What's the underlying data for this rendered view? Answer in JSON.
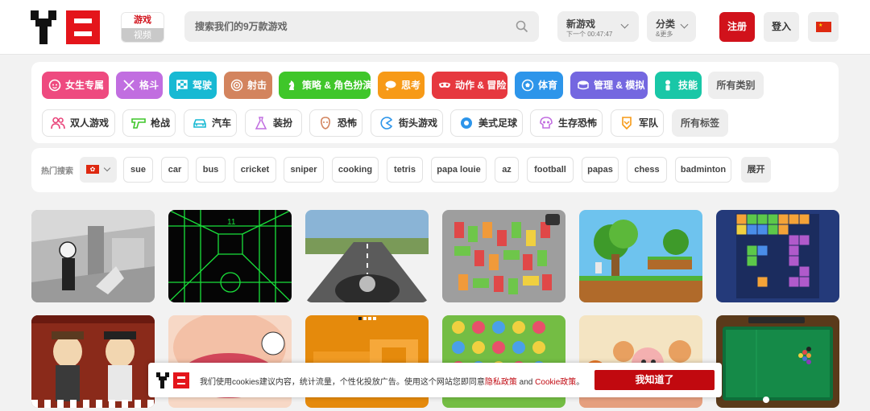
{
  "header": {
    "logo_alt": "Y8",
    "tab_games": "游戏",
    "tab_videos": "视频",
    "search_placeholder": "搜索我们的9万款游戏",
    "new_games_label": "新游戏",
    "new_games_timer": "下一个 00:47:47",
    "categories_label": "分类",
    "categories_sub": "&更多",
    "register": "注册",
    "login": "登入",
    "language_flag": "china-flag"
  },
  "categories": [
    {
      "label": "女生专属",
      "color": "#ee4a7f",
      "icon": "girl-icon"
    },
    {
      "label": "格斗",
      "color": "#c16ee0",
      "icon": "swords-icon"
    },
    {
      "label": "驾驶",
      "color": "#17b9d3",
      "icon": "checkered-flag-icon"
    },
    {
      "label": "射击",
      "color": "#d3845e",
      "icon": "target-icon"
    },
    {
      "label": "策略 & 角色扮演",
      "color": "#3fc62a",
      "icon": "chess-knight-icon"
    },
    {
      "label": "思考",
      "color": "#f79a17",
      "icon": "thought-bubble-icon"
    },
    {
      "label": "动作 & 冒险",
      "color": "#e6383f",
      "icon": "mask-icon"
    },
    {
      "label": "体育",
      "color": "#2d95ea",
      "icon": "soccer-ball-icon"
    },
    {
      "label": "管理 & 模拟",
      "color": "#7467e0",
      "icon": "management-icon"
    },
    {
      "label": "技能",
      "color": "#19c7a7",
      "icon": "skill-icon"
    }
  ],
  "all_categories": "所有类别",
  "tags": [
    {
      "label": "双人游戏",
      "color": "#e9477c",
      "icon": "two-players-icon"
    },
    {
      "label": "枪战",
      "color": "#3fc62a",
      "icon": "gun-icon"
    },
    {
      "label": "汽车",
      "color": "#17b9d3",
      "icon": "car-icon"
    },
    {
      "label": "装扮",
      "color": "#c16ee0",
      "icon": "dress-icon"
    },
    {
      "label": "恐怖",
      "color": "#d3845e",
      "icon": "horror-icon"
    },
    {
      "label": "街头游戏",
      "color": "#2d95ea",
      "icon": "pacman-icon"
    },
    {
      "label": "美式足球",
      "color": "#2d95ea",
      "icon": "football-icon"
    },
    {
      "label": "生存恐怖",
      "color": "#c16ee0",
      "icon": "skull-icon"
    },
    {
      "label": "军队",
      "color": "#f79a17",
      "icon": "military-badge-icon"
    }
  ],
  "all_tags": "所有标签",
  "hot": {
    "label": "热门搜索",
    "region_flag": "hong-kong-flag",
    "keywords": [
      "sue",
      "car",
      "bus",
      "cricket",
      "sniper",
      "cooking",
      "tetris",
      "papa louie",
      "az",
      "football",
      "papas",
      "chess",
      "badminton"
    ],
    "expand": "展开"
  },
  "games": [
    {
      "name": "game-thumb-stickman-office"
    },
    {
      "name": "game-thumb-neon-tunnel"
    },
    {
      "name": "game-thumb-motorbike-highway"
    },
    {
      "name": "game-thumb-parking-jam"
    },
    {
      "name": "game-thumb-pixel-platformer"
    },
    {
      "name": "game-thumb-block-puzzle"
    },
    {
      "name": "game-thumb-cowboy-duel"
    },
    {
      "name": "game-thumb-dentist"
    },
    {
      "name": "game-thumb-orange-puzzle"
    },
    {
      "name": "game-thumb-flower-match"
    },
    {
      "name": "game-thumb-fruit-cooking"
    },
    {
      "name": "game-thumb-pool-billiards"
    }
  ],
  "thumb_timer": "",
  "cookie": {
    "text_before": "我们使用cookies建议内容，统计流量，个性化投放广告。使用这个网站您即同意",
    "privacy_link": "隐私政策",
    "and": " and ",
    "cookie_link": "Cookie政策",
    "period": "。",
    "accept": "我知道了"
  }
}
